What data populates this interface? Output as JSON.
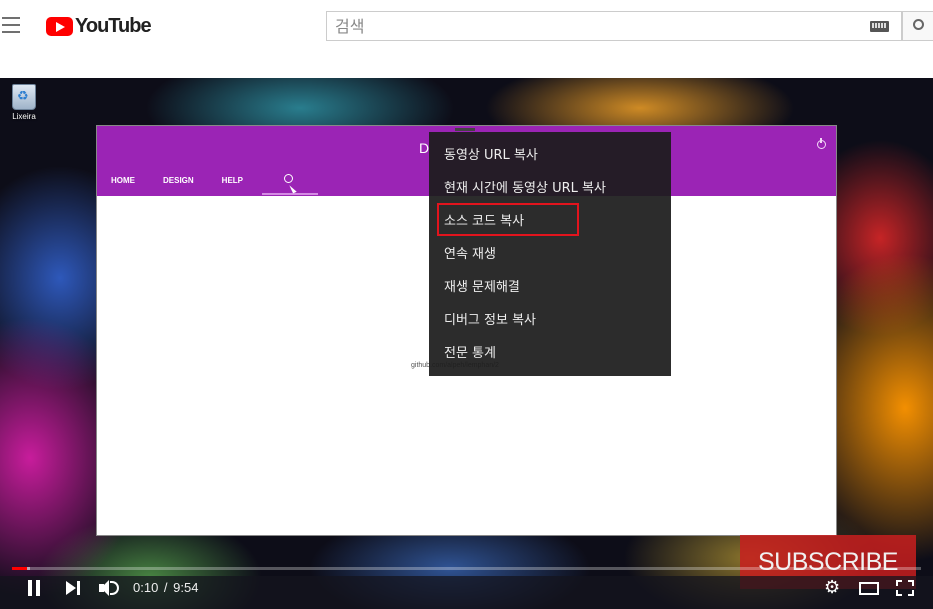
{
  "masthead": {
    "logo_text": "YouTube",
    "search_placeholder": "검색"
  },
  "video": {
    "desktop_icon_label": "Lixeira",
    "app": {
      "title": "D",
      "nav": [
        "HOME",
        "DESIGN",
        "HELP"
      ],
      "footer_text": "github.com/alpeh/lemphan/2"
    },
    "context_menu": {
      "items": [
        "동영상 URL 복사",
        "현재 시간에 동영상 URL 복사",
        "소스 코드 복사",
        "연속 재생",
        "재생 문제해결",
        "디버그 정보 복사",
        "전문 통계"
      ],
      "highlighted_index": 2,
      "highlight_color": "#e2141d"
    },
    "subscribe_label": "SUBSCRIBE",
    "controls": {
      "current_time": "0:10",
      "duration": "9:54",
      "progress_fraction": 0.017,
      "loaded_fraction": 0.02
    }
  },
  "colors": {
    "youtube_red": "#ff0000",
    "app_header_purple": "#9b24b5",
    "progress_red": "#ff0000"
  }
}
